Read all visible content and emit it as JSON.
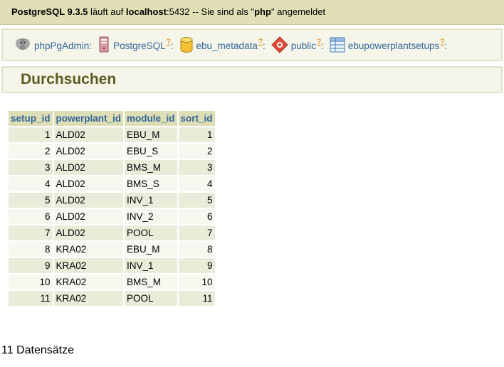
{
  "topbar": {
    "product": "PostgreSQL 9.3.5",
    "text1": " läuft auf ",
    "host": "localhost",
    "text2": ":5432 -- Sie sind als \"",
    "user": "php",
    "text3": "\" angemeldet"
  },
  "trail": [
    {
      "label": "phpPgAdmin",
      "icon": "elephant-icon",
      "help": ""
    },
    {
      "label": "PostgreSQL",
      "icon": "server-icon",
      "help": "?"
    },
    {
      "label": "ebu_metadata",
      "icon": "database-icon",
      "help": "?"
    },
    {
      "label": "public",
      "icon": "schema-icon",
      "help": "?"
    },
    {
      "label": "ebupowerplantsetups",
      "icon": "table-icon",
      "help": "?"
    }
  ],
  "trail_separator": ":",
  "page_title": "Durchsuchen",
  "table": {
    "columns": [
      "setup_id",
      "powerplant_id",
      "module_id",
      "sort_id"
    ],
    "rows": [
      [
        "1",
        "ALD02",
        "EBU_M",
        "1"
      ],
      [
        "2",
        "ALD02",
        "EBU_S",
        "2"
      ],
      [
        "3",
        "ALD02",
        "BMS_M",
        "3"
      ],
      [
        "4",
        "ALD02",
        "BMS_S",
        "4"
      ],
      [
        "5",
        "ALD02",
        "INV_1",
        "5"
      ],
      [
        "6",
        "ALD02",
        "INV_2",
        "6"
      ],
      [
        "7",
        "ALD02",
        "POOL",
        "7"
      ],
      [
        "8",
        "KRA02",
        "EBU_M",
        "8"
      ],
      [
        "9",
        "KRA02",
        "INV_1",
        "9"
      ],
      [
        "10",
        "KRA02",
        "BMS_M",
        "10"
      ],
      [
        "11",
        "KRA02",
        "POOL",
        "11"
      ]
    ]
  },
  "record_count": "11 Datensätze",
  "colors": {
    "header_bar": "#e0dfb6",
    "link": "#336699",
    "title": "#5b5b21",
    "help_mark": "#e08000"
  }
}
